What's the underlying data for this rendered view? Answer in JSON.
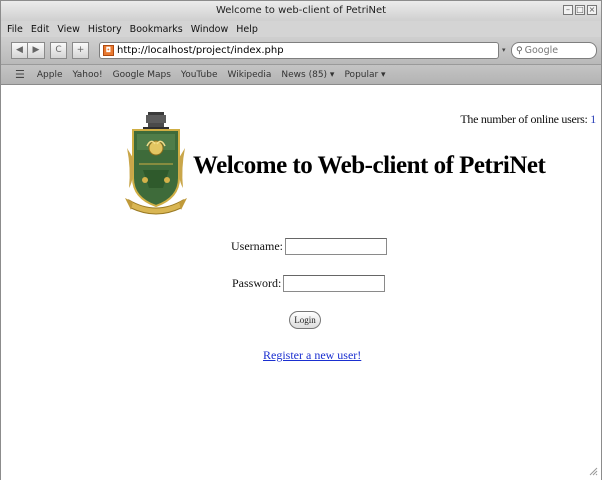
{
  "window": {
    "title": "Welcome to web-client of PetriNet",
    "controls": [
      "minimize-icon",
      "maximize-icon",
      "close-icon"
    ]
  },
  "menu": {
    "items": [
      "File",
      "Edit",
      "View",
      "History",
      "Bookmarks",
      "Window",
      "Help"
    ]
  },
  "toolbar": {
    "back_glyph": "◀",
    "forward_glyph": "▶",
    "reload_glyph": "C",
    "add_glyph": "+",
    "url": "http://localhost/project/index.php",
    "search_placeholder": "Google"
  },
  "bookmarks": {
    "items": [
      "Apple",
      "Yahoo!",
      "Google Maps",
      "YouTube",
      "Wikipedia",
      "News (85) ▾",
      "Popular ▾"
    ]
  },
  "page": {
    "online_label": "The number of online users:",
    "online_count": "1",
    "title": "Welcome to Web-client of PetriNet",
    "username_label": "Username:",
    "username_value": "",
    "password_label": "Password:",
    "password_value": "",
    "login_label": "Login",
    "register_link": "Register a new user!"
  },
  "colors": {
    "link": "#1a2fd0",
    "online_count": "#2a3fb8",
    "crest_green": "#3e6b3a",
    "crest_gold": "#d4b24a"
  }
}
